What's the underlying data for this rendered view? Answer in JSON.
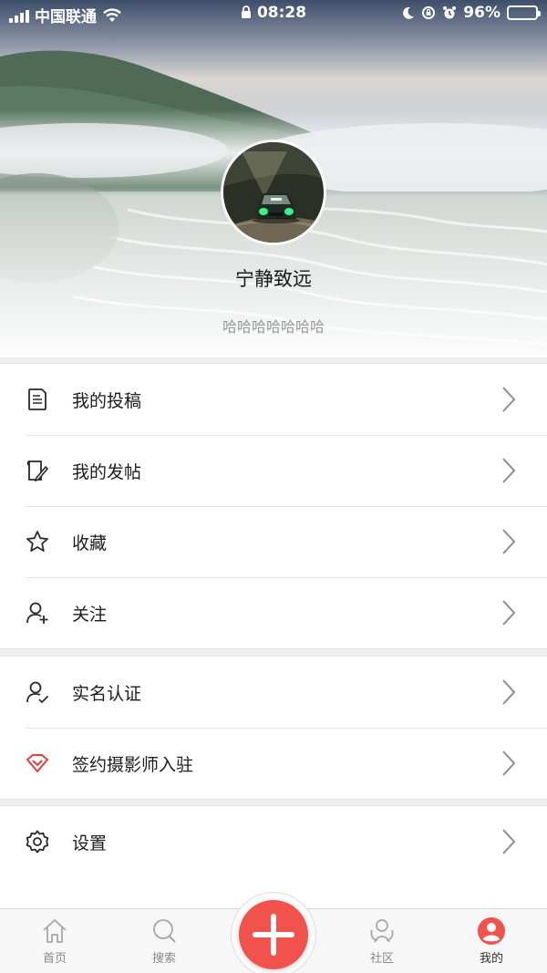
{
  "status_bar": {
    "carrier": "中国联通",
    "time": "08:28",
    "battery": "96%",
    "battery_level": 0.96
  },
  "profile": {
    "username": "宁静致远",
    "bio": "哈哈哈哈哈哈哈"
  },
  "menu_groups": [
    {
      "items": [
        {
          "label": "我的投稿",
          "icon": "document-icon"
        },
        {
          "label": "我的发帖",
          "icon": "post-icon"
        },
        {
          "label": "收藏",
          "icon": "star-icon"
        },
        {
          "label": "关注",
          "icon": "user-plus-icon"
        }
      ]
    },
    {
      "items": [
        {
          "label": "实名认证",
          "icon": "user-check-icon"
        },
        {
          "label": "签约摄影师入驻",
          "icon": "diamond-icon"
        }
      ]
    },
    {
      "items": [
        {
          "label": "设置",
          "icon": "gear-icon"
        }
      ]
    }
  ],
  "tab_bar": {
    "tabs": [
      {
        "label": "首页",
        "icon": "home-icon"
      },
      {
        "label": "搜索",
        "icon": "search-icon"
      },
      {
        "label": "社区",
        "icon": "community-icon"
      },
      {
        "label": "我的",
        "icon": "profile-icon"
      }
    ],
    "active_tab": "我的",
    "fab_icon": "plus-icon"
  },
  "colors": {
    "accent": "#f1524c",
    "diamond": "#e2403b",
    "text_primary": "#1d1d1d",
    "text_secondary": "#9a9a9a"
  }
}
